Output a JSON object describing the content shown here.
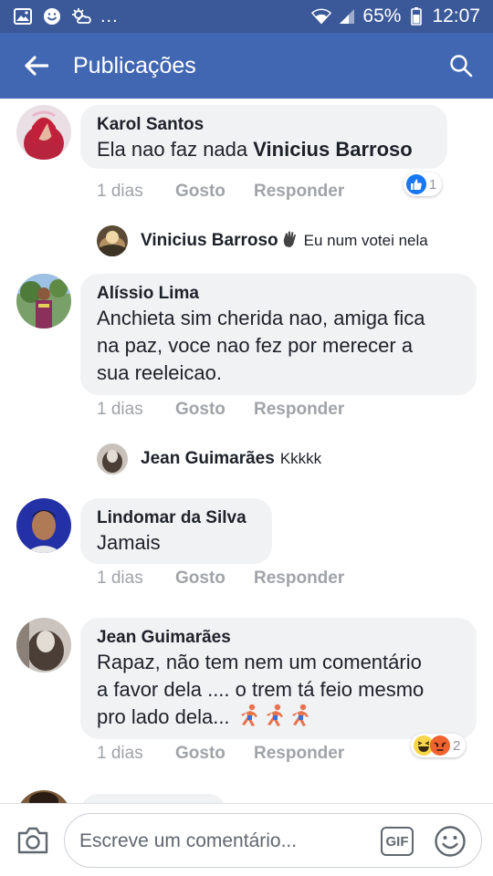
{
  "status_bar": {
    "dots": "...",
    "battery": "65%",
    "time": "12:07"
  },
  "app_bar": {
    "title": "Publicações"
  },
  "comments": [
    {
      "author": "Karol Santos",
      "text": "Ela nao faz nada",
      "mention": "Vinicius Barroso",
      "time": "1 dias",
      "like_label": "Gosto",
      "reply_label": "Responder",
      "reaction_count": "1",
      "reply": {
        "author": "Vinicius Barroso",
        "text": "Eu num votei nela"
      }
    },
    {
      "author": "Alíssio Lima",
      "text_lines": [
        "Anchieta sim cherida nao, amiga fica",
        "na paz, voce nao fez por merecer a",
        "sua reeleicao."
      ],
      "time": "1 dias",
      "like_label": "Gosto",
      "reply_label": "Responder",
      "reply": {
        "author": "Jean Guimarães",
        "text": "Kkkkk"
      }
    },
    {
      "author": "Lindomar da Silva",
      "text": "Jamais",
      "time": "1 dias",
      "like_label": "Gosto",
      "reply_label": "Responder"
    },
    {
      "author": "Jean Guimarães",
      "text_lines": [
        "Rapaz, não tem nem um comentário",
        "a favor dela .... o trem tá feio mesmo",
        "pro lado dela..."
      ],
      "time": "1 dias",
      "like_label": "Gosto",
      "reply_label": "Responder",
      "reaction_count": "2"
    }
  ],
  "composer": {
    "placeholder": "Escreve um comentário...",
    "gif_label": "GIF"
  },
  "colors": {
    "status_bar": "#3b5998",
    "app_bar": "#4267b2",
    "bubble": "#f1f2f4",
    "meta_text": "#a0a3a8",
    "like_blue": "#1877f2",
    "haha_yellow": "#f7d64a",
    "angry_orange": "#f0632f"
  }
}
